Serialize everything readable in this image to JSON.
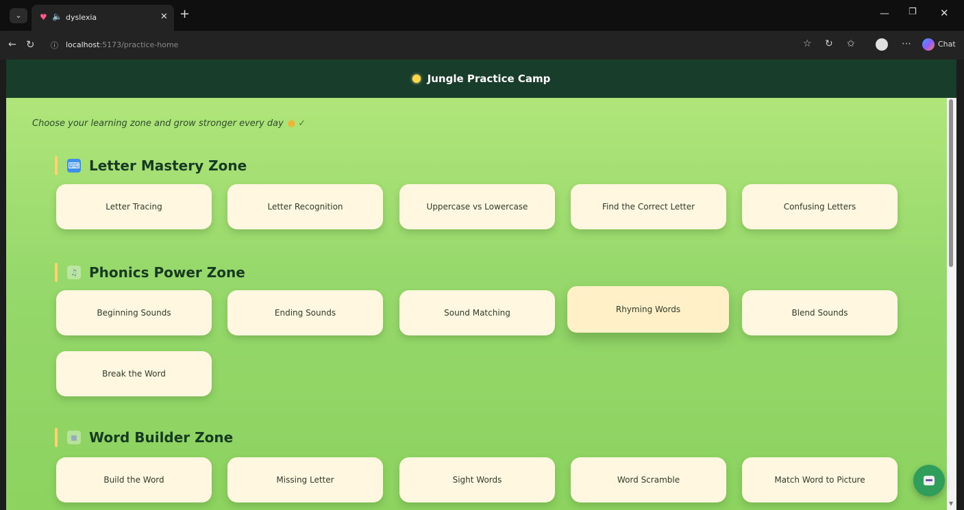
{
  "browser": {
    "tab_title": "dyslexia",
    "url_host": "localhost",
    "url_path": ":5173/practice-home",
    "chat_label": "Chat"
  },
  "header": {
    "title": "Jungle Practice Camp"
  },
  "main": {
    "tagline": "Choose your learning zone and grow stronger every day",
    "zones": [
      {
        "name": "Letter Mastery Zone",
        "icon": "abc-icon",
        "cards": [
          "Letter Tracing",
          "Letter Recognition",
          "Uppercase vs Lowercase",
          "Find the Correct Letter",
          "Confusing Letters"
        ]
      },
      {
        "name": "Phonics Power Zone",
        "icon": "music-icon",
        "cards": [
          "Beginning Sounds",
          "Ending Sounds",
          "Sound Matching",
          "Rhyming Words",
          "Blend Sounds",
          "Break the Word"
        ]
      },
      {
        "name": "Word Builder Zone",
        "icon": "blocks-icon",
        "cards": [
          "Build the Word",
          "Missing Letter",
          "Sight Words",
          "Word Scramble",
          "Match Word to Picture"
        ]
      }
    ]
  },
  "colors": {
    "header_bg": "#183d2a",
    "main_bg": "#96d86b",
    "card_bg": "#fff7df",
    "zone_accent": "#ffd36b",
    "fab_bg": "#2f9e5a"
  }
}
